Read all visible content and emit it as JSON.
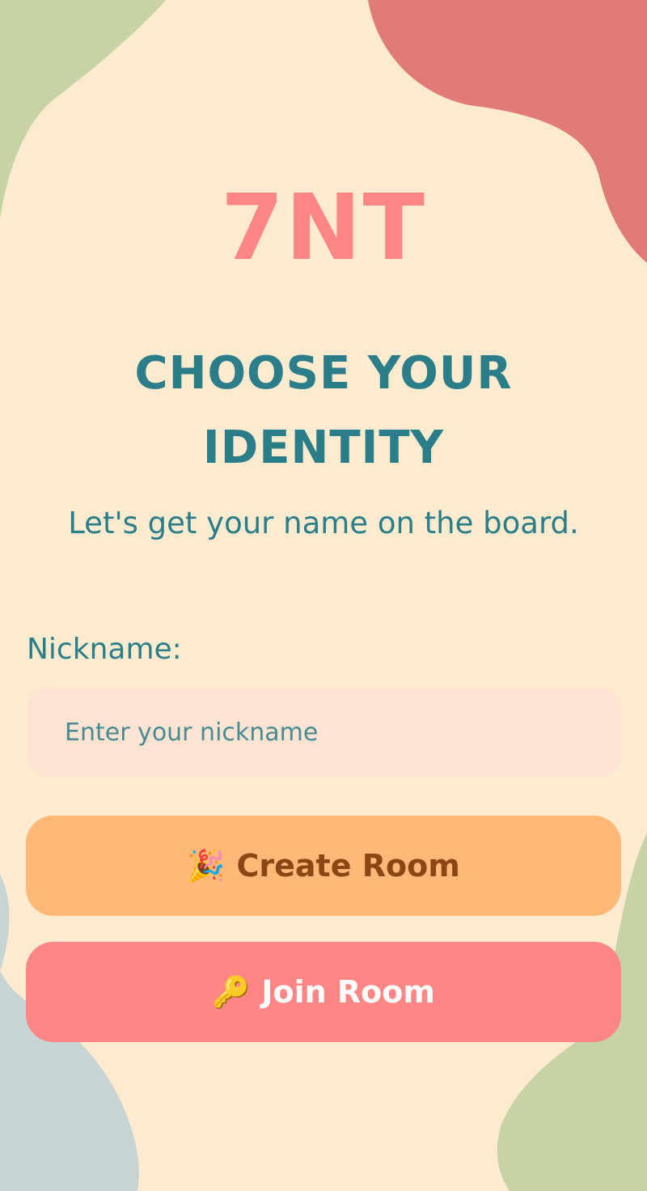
{
  "colors": {
    "background": "#fdebcf",
    "logo": "#ff8684",
    "heading": "#2c7d8a",
    "input_bg": "#fde4d2",
    "placeholder": "#4a8a94",
    "create_bg": "#ffb877",
    "create_text": "#8f4513",
    "join_bg": "#ff8684",
    "join_text": "#ffffff",
    "blob_green": "#c7d2a5",
    "blob_red": "#e07b78",
    "blob_blue": "#c8d4d4"
  },
  "app": {
    "logo": "7NT"
  },
  "header": {
    "title": "CHOOSE YOUR IDENTITY",
    "subtitle": "Let's get your name on the board."
  },
  "form": {
    "nickname_label": "Nickname:",
    "nickname_value": "",
    "nickname_placeholder": "Enter your nickname"
  },
  "actions": {
    "create_icon": "party-popper-icon",
    "create_emoji": "🎉",
    "create_label": "Create Room",
    "join_icon": "key-icon",
    "join_emoji": "🔑",
    "join_label": "Join Room"
  }
}
